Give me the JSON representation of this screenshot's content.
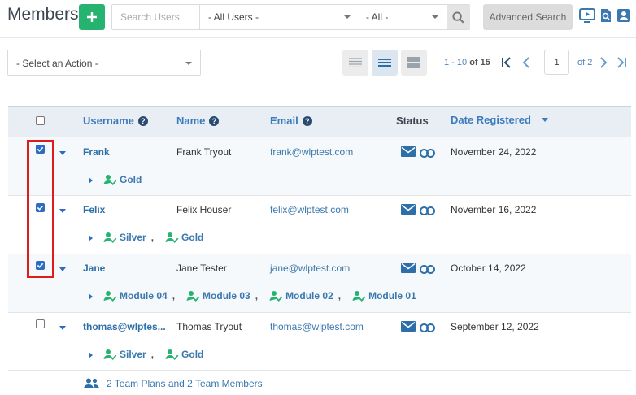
{
  "header": {
    "title": "Members",
    "search_placeholder": "Search Users",
    "filter_levels": "- All Users -",
    "filter_status": "- All -",
    "advanced_search": "Advanced Search"
  },
  "toolbar": {
    "action_select": "- Select an Action -",
    "range": "1 - 10",
    "of_total": "of 15",
    "page": "1",
    "of_pages": "of 2"
  },
  "table": {
    "columns": {
      "username": "Username",
      "name": "Name",
      "email": "Email",
      "status": "Status",
      "date": "Date Registered"
    },
    "rows": [
      {
        "username": "Frank",
        "name": "Frank Tryout",
        "email": "frank@wlptest.com",
        "date": "November 24, 2022",
        "checked": true,
        "levels": [
          "Gold"
        ]
      },
      {
        "username": "Felix",
        "name": "Felix Houser",
        "email": "felix@wlptest.com",
        "date": "November 16, 2022",
        "checked": true,
        "levels": [
          "Silver",
          "Gold"
        ]
      },
      {
        "username": "Jane",
        "name": "Jane Tester",
        "email": "jane@wlptest.com",
        "date": "October 14, 2022",
        "checked": true,
        "levels": [
          "Module 04",
          "Module 03",
          "Module 02",
          "Module 01"
        ]
      },
      {
        "username": "thomas@wlptes...",
        "name": "Thomas Tryout",
        "email": "thomas@wlptest.com",
        "date": "September 12, 2022",
        "checked": false,
        "levels": [
          "Silver",
          "Gold"
        ]
      }
    ],
    "team_info": "2 Team Plans and 2 Team Members"
  },
  "colors": {
    "accent": "#26b36f",
    "link": "#3b78ae",
    "highlight": "#e01b1b"
  }
}
